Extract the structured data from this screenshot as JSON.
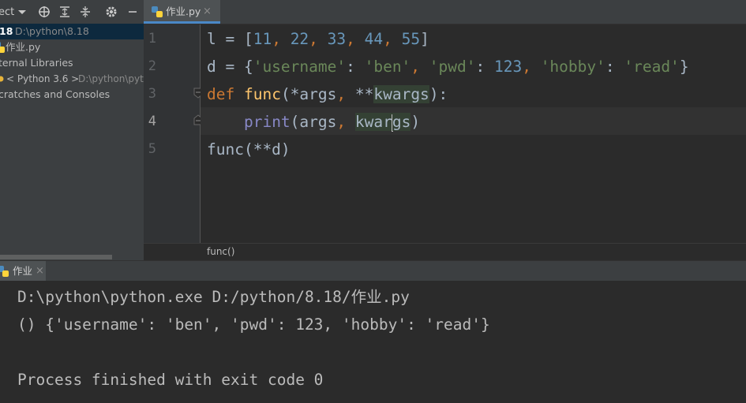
{
  "project_panel": {
    "title_partial": "ect",
    "tree": [
      {
        "name": "18",
        "path": "D:\\python\\8.18"
      },
      {
        "name": "作业.py"
      },
      {
        "name": "ternal Libraries"
      },
      {
        "name": "< Python 3.6 >",
        "path": "D:\\python\\pyth"
      },
      {
        "name": "cratches and Consoles"
      }
    ]
  },
  "editor": {
    "tab_label": "作业.py",
    "close_glyph": "×",
    "line_numbers": [
      "1",
      "2",
      "3",
      "4",
      "5"
    ],
    "lines": [
      [
        [
          "plain",
          "l = "
        ],
        [
          "plain",
          "["
        ],
        [
          "num",
          "11"
        ],
        [
          "kw",
          ", "
        ],
        [
          "num",
          "22"
        ],
        [
          "kw",
          ", "
        ],
        [
          "num",
          "33"
        ],
        [
          "kw",
          ", "
        ],
        [
          "num",
          "44"
        ],
        [
          "kw",
          ", "
        ],
        [
          "num",
          "55"
        ],
        [
          "plain",
          "]"
        ]
      ],
      [
        [
          "plain",
          "d = {"
        ],
        [
          "str",
          "'username'"
        ],
        [
          "plain",
          ": "
        ],
        [
          "str",
          "'ben'"
        ],
        [
          "kw",
          ", "
        ],
        [
          "str",
          "'pwd'"
        ],
        [
          "plain",
          ": "
        ],
        [
          "num",
          "123"
        ],
        [
          "kw",
          ", "
        ],
        [
          "str",
          "'hobby'"
        ],
        [
          "plain",
          ": "
        ],
        [
          "str",
          "'read'"
        ],
        [
          "plain",
          "}"
        ]
      ],
      [
        [
          "kw",
          "def "
        ],
        [
          "fn",
          "func"
        ],
        [
          "plain",
          "(*args"
        ],
        [
          "kw",
          ", "
        ],
        [
          "plain",
          "**"
        ],
        [
          "hl",
          "kwargs"
        ],
        [
          "plain",
          "):"
        ]
      ],
      [
        [
          "plain",
          "    "
        ],
        [
          "bi",
          "print"
        ],
        [
          "plain",
          "(args"
        ],
        [
          "kw",
          ", "
        ],
        [
          "hl",
          "kwar"
        ],
        [
          "caret",
          ""
        ],
        [
          "hl",
          "gs"
        ],
        [
          "plain",
          ")"
        ]
      ],
      [
        [
          "plain",
          "func(**d)"
        ]
      ]
    ],
    "breadcrumb": "func()"
  },
  "run_panel": {
    "tab_label": "作业",
    "close_glyph": "×",
    "output": [
      "D:\\python\\python.exe D:/python/8.18/作业.py",
      "() {'username': 'ben', 'pwd': 123, 'hobby': 'read'}",
      "",
      "Process finished with exit code 0"
    ]
  },
  "colors": {
    "keyword": "#cc7832",
    "string": "#6a8759",
    "number": "#6897bb",
    "function": "#ffc66d",
    "builtin": "#8888c6",
    "identifier_highlight": "#344134",
    "selection": "#0d293e",
    "accent": "#4a88c7"
  }
}
